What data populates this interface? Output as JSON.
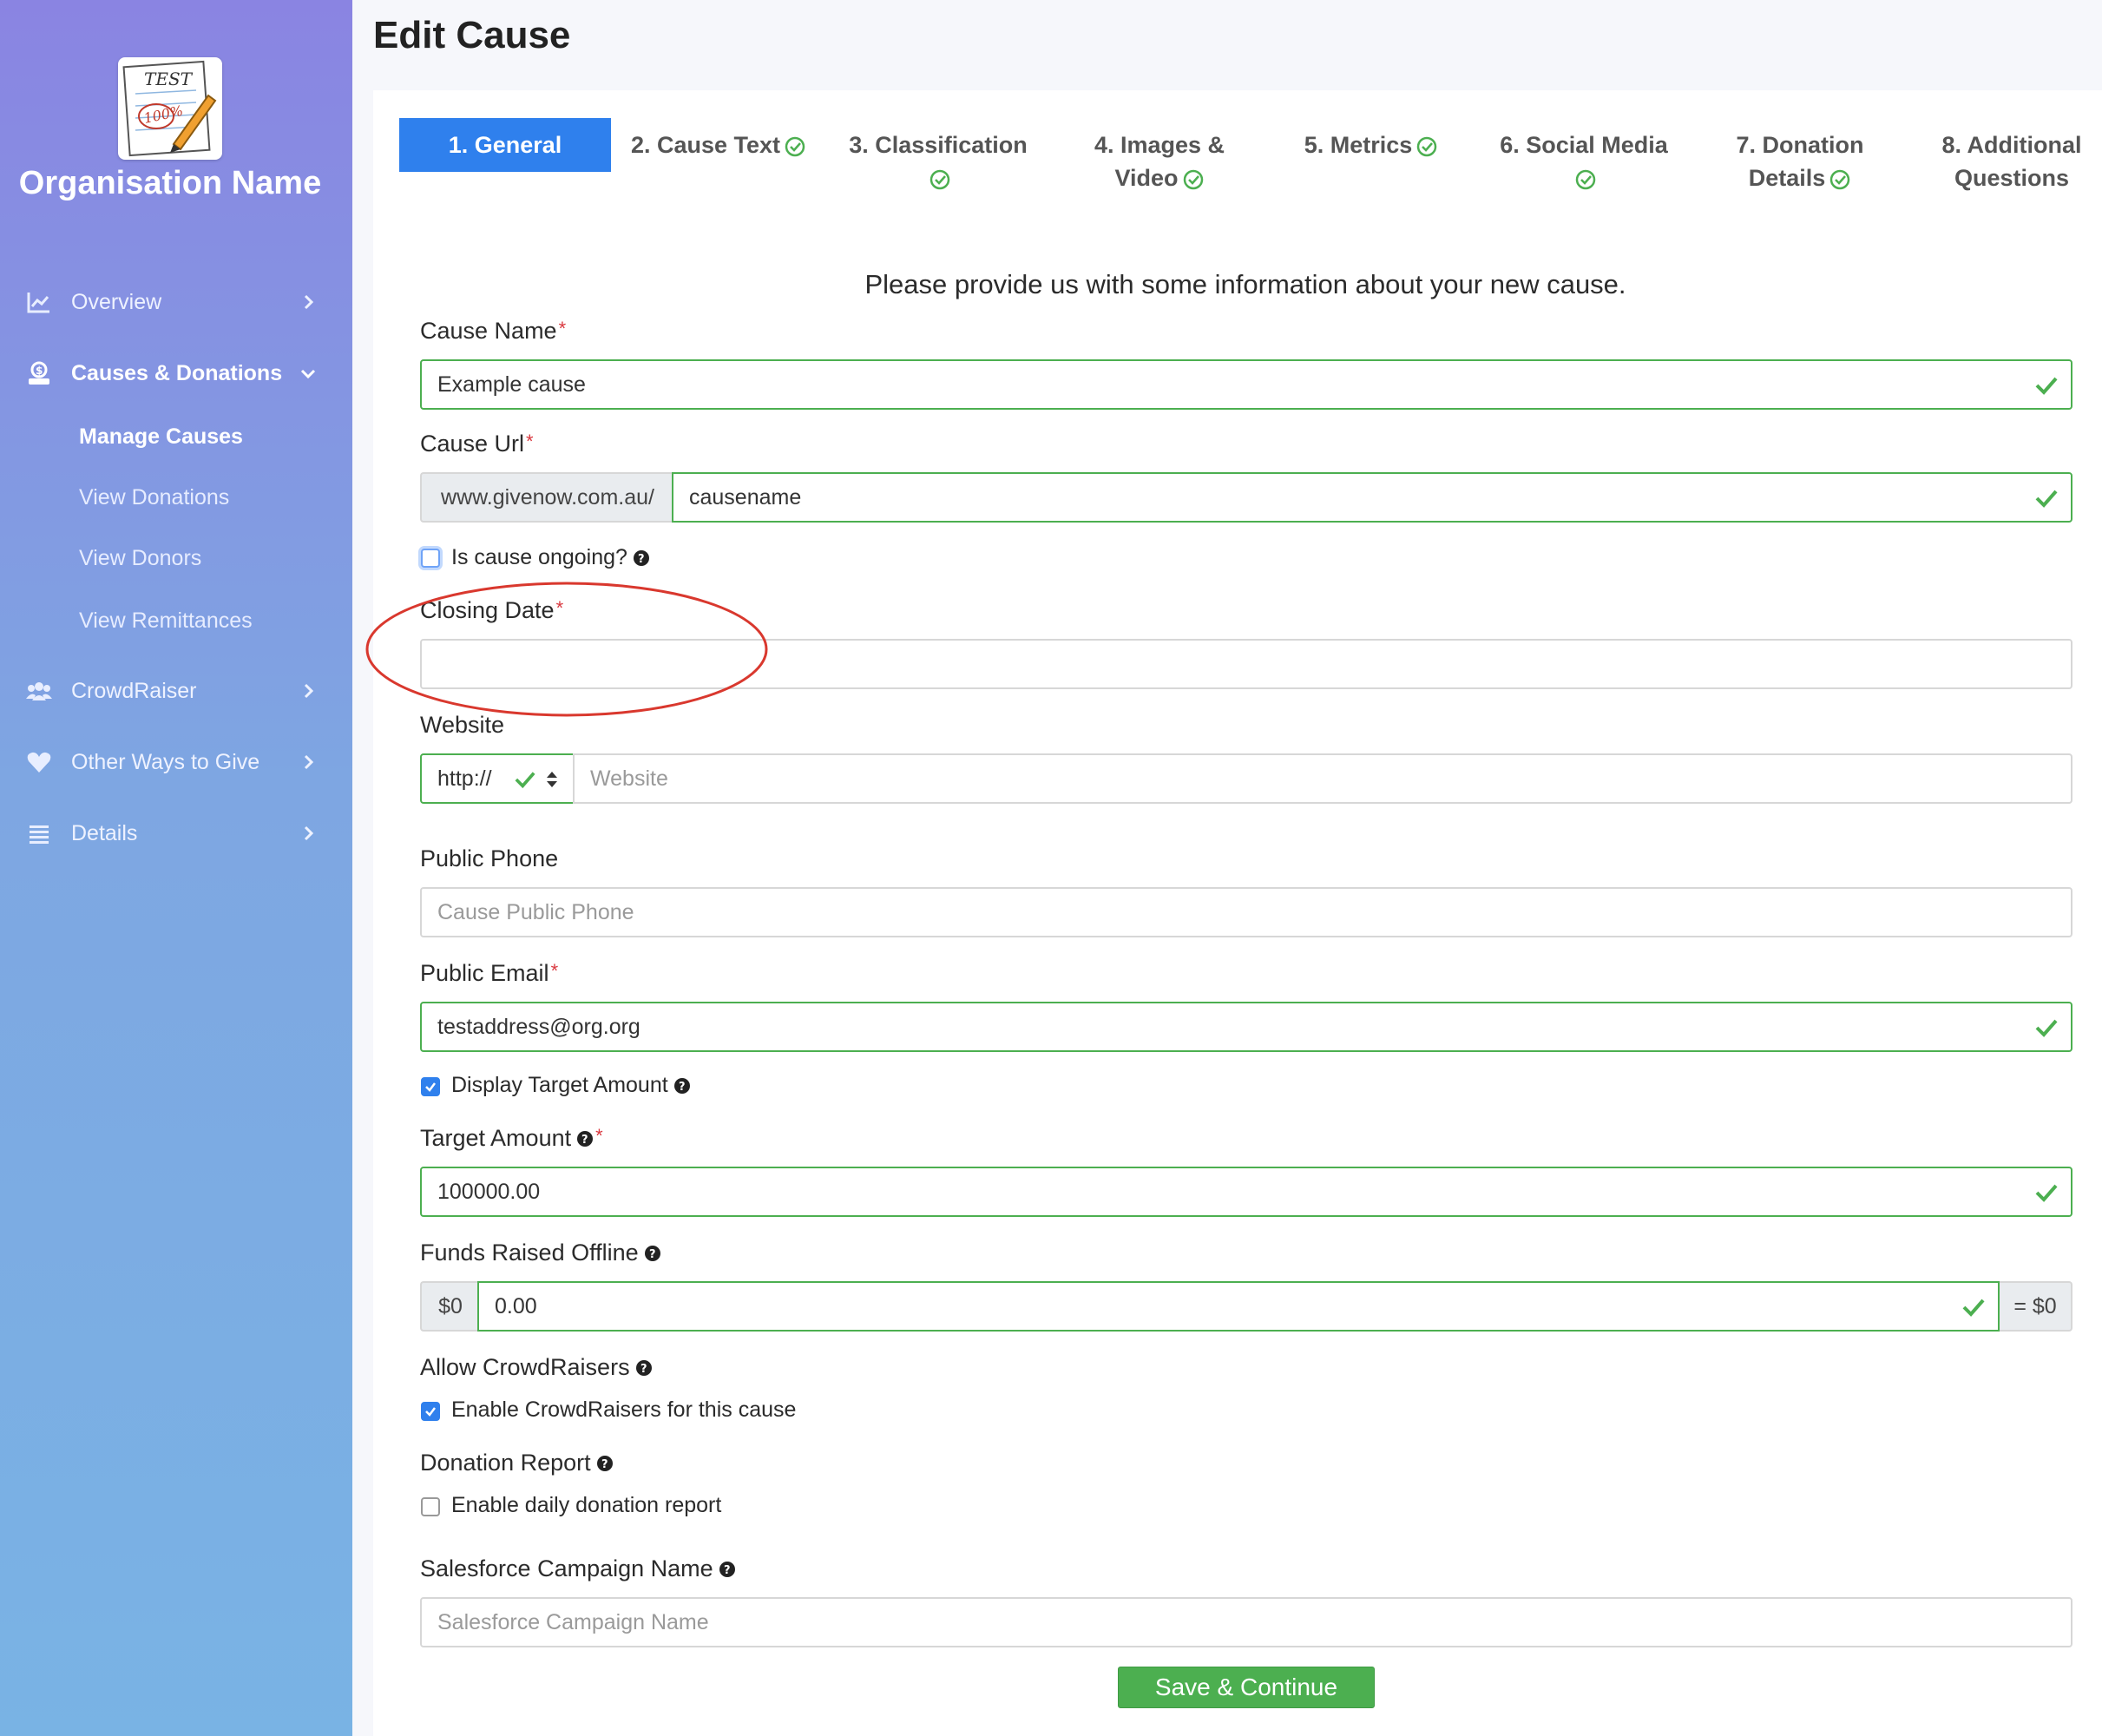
{
  "page": {
    "title": "Edit Cause"
  },
  "sidebar": {
    "org_name": "Organisation Name",
    "logo_text": "TEST",
    "logo_score": "100%",
    "nav": [
      {
        "label": "Overview",
        "icon": "chart-line-icon"
      },
      {
        "label": "Causes & Donations",
        "icon": "donate-icon"
      },
      {
        "label": "CrowdRaiser",
        "icon": "users-icon"
      },
      {
        "label": "Other Ways to Give",
        "icon": "heart-icon"
      },
      {
        "label": "Details",
        "icon": "list-icon"
      }
    ],
    "sub_items": [
      {
        "label": "Manage Causes"
      },
      {
        "label": "View Donations"
      },
      {
        "label": "View Donors"
      },
      {
        "label": "View Remittances"
      }
    ]
  },
  "tabs": [
    {
      "line1": "1. General",
      "line2": ""
    },
    {
      "line1": "2. Cause Text",
      "line2": ""
    },
    {
      "line1": "3. Classification",
      "line2": ""
    },
    {
      "line1": "4. Images &",
      "line2": "Video"
    },
    {
      "line1": "5. Metrics",
      "line2": ""
    },
    {
      "line1": "6. Social Media",
      "line2": ""
    },
    {
      "line1": "7. Donation",
      "line2": "Details"
    },
    {
      "line1": "8. Additional",
      "line2": "Questions"
    }
  ],
  "form": {
    "intro": "Please provide us with some information about your new cause.",
    "required_mark": "*",
    "cause_name": {
      "label": "Cause Name",
      "value": "Example cause"
    },
    "cause_url": {
      "label": "Cause Url",
      "prefix": "www.givenow.com.au/",
      "value": "causename"
    },
    "ongoing": {
      "label": "Is cause ongoing?"
    },
    "closing_date": {
      "label": "Closing Date",
      "value": ""
    },
    "website": {
      "label": "Website",
      "protocol": "http://",
      "placeholder": "Website"
    },
    "public_phone": {
      "label": "Public Phone",
      "placeholder": "Cause Public Phone"
    },
    "public_email": {
      "label": "Public Email",
      "value": "testaddress@org.org"
    },
    "display_target": {
      "label": "Display Target Amount"
    },
    "target_amount": {
      "label": "Target Amount",
      "value": "100000.00"
    },
    "funds_offline": {
      "label": "Funds Raised Offline",
      "prefix": "$0",
      "value": "0.00",
      "suffix": "= $0"
    },
    "allow_crowdraisers": {
      "label": "Allow CrowdRaisers",
      "checkbox_label": "Enable CrowdRaisers for this cause"
    },
    "donation_report": {
      "label": "Donation Report",
      "checkbox_label": "Enable daily donation report"
    },
    "salesforce": {
      "label": "Salesforce Campaign Name",
      "placeholder": "Salesforce Campaign Name"
    },
    "save_label": "Save & Continue"
  },
  "colors": {
    "accent": "#2f80ed",
    "valid": "#4caf50",
    "annotation": "#d9382e"
  }
}
